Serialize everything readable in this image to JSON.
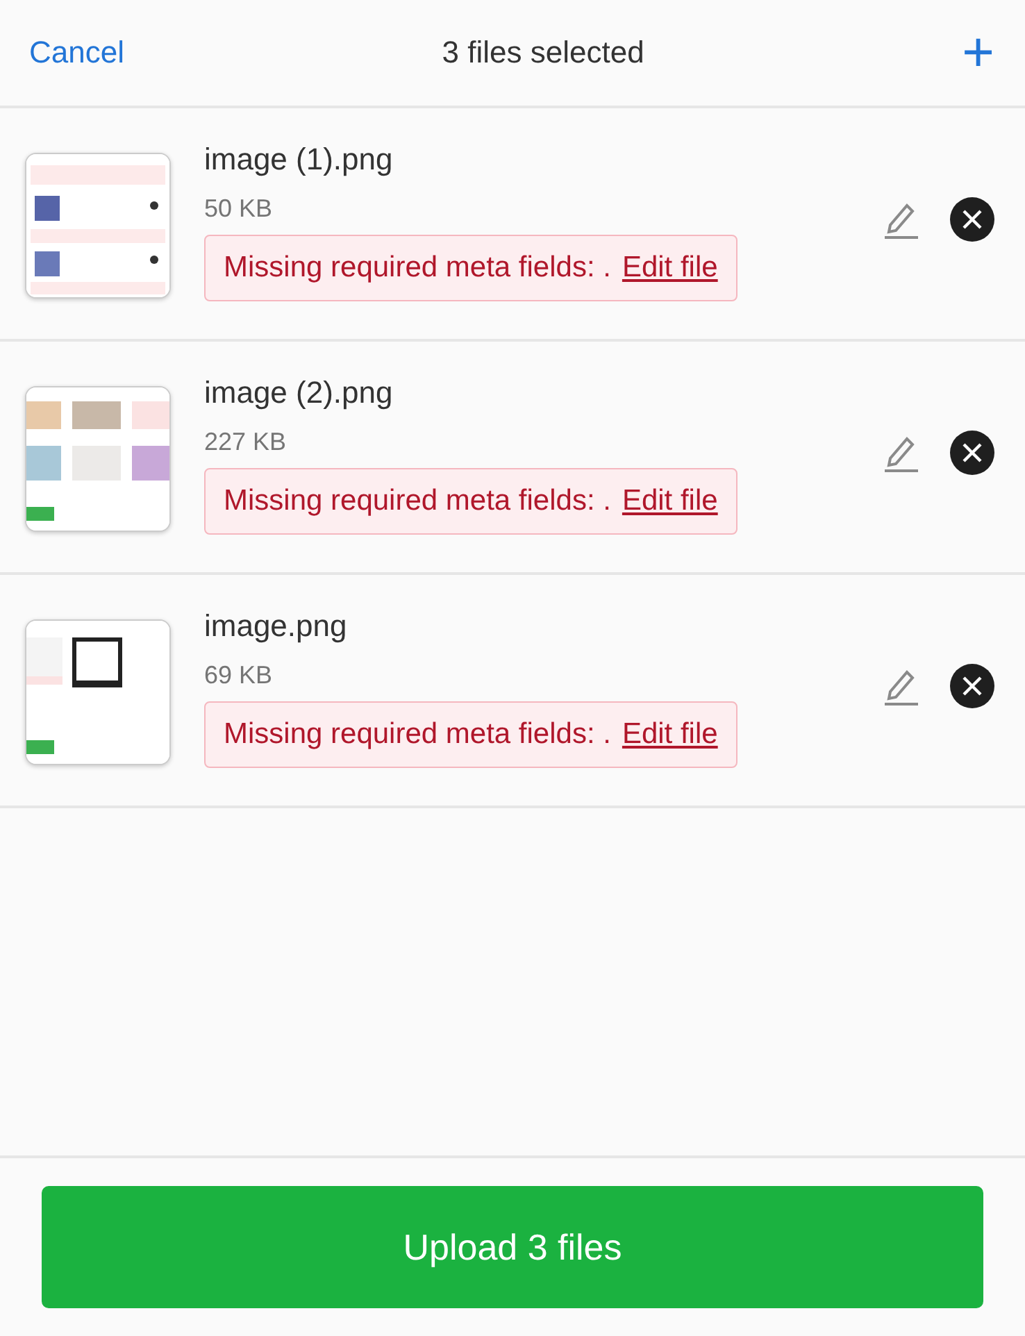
{
  "header": {
    "cancel": "Cancel",
    "title": "3 files selected",
    "add": "+"
  },
  "files": [
    {
      "name": "image (1).png",
      "size": "50 KB",
      "error": "Missing required meta fields: .",
      "error_link": "Edit file"
    },
    {
      "name": "image (2).png",
      "size": "227 KB",
      "error": "Missing required meta fields: .",
      "error_link": "Edit file"
    },
    {
      "name": "image.png",
      "size": "69 KB",
      "error": "Missing required meta fields: .",
      "error_link": "Edit file"
    }
  ],
  "upload_button": "Upload 3 files"
}
